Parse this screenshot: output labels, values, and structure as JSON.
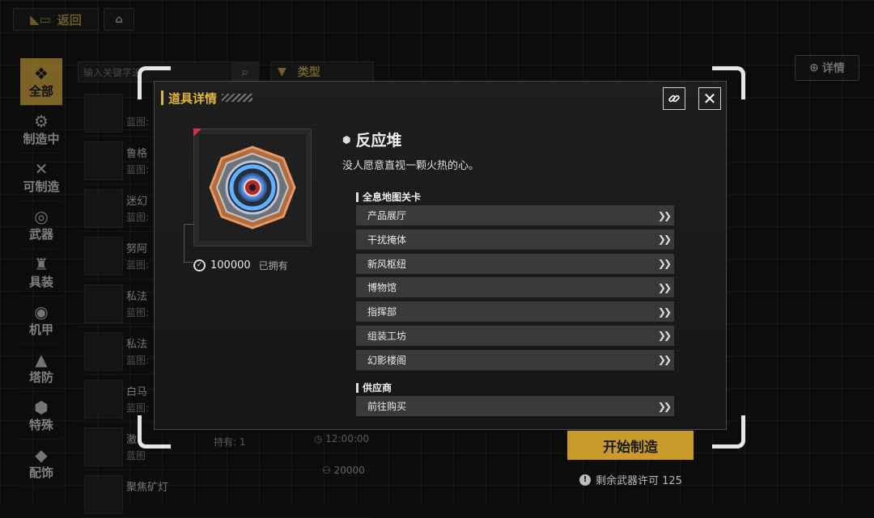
{
  "topbar": {
    "back_label": "返回",
    "home_icon": "home-icon"
  },
  "sidebar": {
    "items": [
      {
        "label": "全部",
        "icon": "all-icon",
        "active": true
      },
      {
        "label": "制造中",
        "icon": "gear-icon"
      },
      {
        "label": "可制造",
        "icon": "tools-icon"
      },
      {
        "label": "武器",
        "icon": "target-icon"
      },
      {
        "label": "具装",
        "icon": "armor-icon"
      },
      {
        "label": "机甲",
        "icon": "mech-icon"
      },
      {
        "label": "塔防",
        "icon": "tower-icon"
      },
      {
        "label": "特殊",
        "icon": "special-icon"
      },
      {
        "label": "配饰",
        "icon": "accessory-icon"
      }
    ]
  },
  "search": {
    "placeholder": "输入关键字进",
    "type_label": "类型"
  },
  "blueprints": [
    {
      "name": "",
      "label": "蓝图:"
    },
    {
      "name": "鲁格",
      "label": "蓝图:"
    },
    {
      "name": "迷幻",
      "label": "蓝图:"
    },
    {
      "name": "努阿",
      "label": "蓝图:"
    },
    {
      "name": "私法",
      "label": "蓝图:"
    },
    {
      "name": "私法",
      "label": "蓝图:"
    },
    {
      "name": "白马",
      "label": "蓝图:"
    },
    {
      "name": "激",
      "label": "蓝图"
    },
    {
      "name": "聚焦矿灯",
      "label": ""
    }
  ],
  "blueprint_hold": "持有: 1",
  "blueprint_time": "12:00:00",
  "blueprint_cost": "20000",
  "detail_button": "详情",
  "start_button": "开始制造",
  "permit_text": "剩余武器许可 125",
  "modal": {
    "title": "道具详情",
    "item_name": "反应堆",
    "item_desc": "没人愿意直视一颗火热的心。",
    "owned_count": "100000",
    "owned_label": "已拥有",
    "section_sources": "全息地图关卡",
    "sources": [
      "产品展厅",
      "干扰掩体",
      "新风枢纽",
      "博物馆",
      "指挥部",
      "组装工坊",
      "幻影楼阁"
    ],
    "section_supplier": "供应商",
    "supplier_action": "前往购买"
  }
}
